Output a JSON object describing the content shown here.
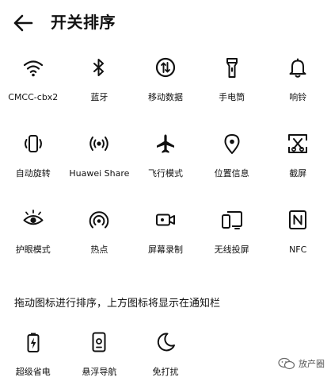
{
  "header": {
    "title": "开关排序"
  },
  "tiles": [
    {
      "label": "CMCC-cbx2",
      "icon": "wifi-icon"
    },
    {
      "label": "蓝牙",
      "icon": "bluetooth-icon"
    },
    {
      "label": "移动数据",
      "icon": "mobile-data-icon"
    },
    {
      "label": "手电筒",
      "icon": "flashlight-icon"
    },
    {
      "label": "响铃",
      "icon": "bell-icon"
    },
    {
      "label": "自动旋转",
      "icon": "auto-rotate-icon"
    },
    {
      "label": "Huawei Share",
      "icon": "huawei-share-icon"
    },
    {
      "label": "飞行模式",
      "icon": "airplane-icon"
    },
    {
      "label": "位置信息",
      "icon": "location-icon"
    },
    {
      "label": "截屏",
      "icon": "screenshot-icon"
    },
    {
      "label": "护眼模式",
      "icon": "eye-icon"
    },
    {
      "label": "热点",
      "icon": "hotspot-icon"
    },
    {
      "label": "屏幕录制",
      "icon": "screen-record-icon"
    },
    {
      "label": "无线投屏",
      "icon": "wireless-projection-icon"
    },
    {
      "label": "NFC",
      "icon": "nfc-icon"
    }
  ],
  "hint": "拖动图标进行排序，上方图标将显示在通知栏",
  "extra_tiles": [
    {
      "label": "超级省电",
      "icon": "battery-saver-icon"
    },
    {
      "label": "悬浮导航",
      "icon": "floating-nav-icon"
    },
    {
      "label": "免打扰",
      "icon": "moon-icon"
    }
  ],
  "watermark": {
    "text": "放产圈",
    "icon": "wechat-icon"
  },
  "colors": {
    "background": "#ffffff",
    "text": "#111111"
  }
}
